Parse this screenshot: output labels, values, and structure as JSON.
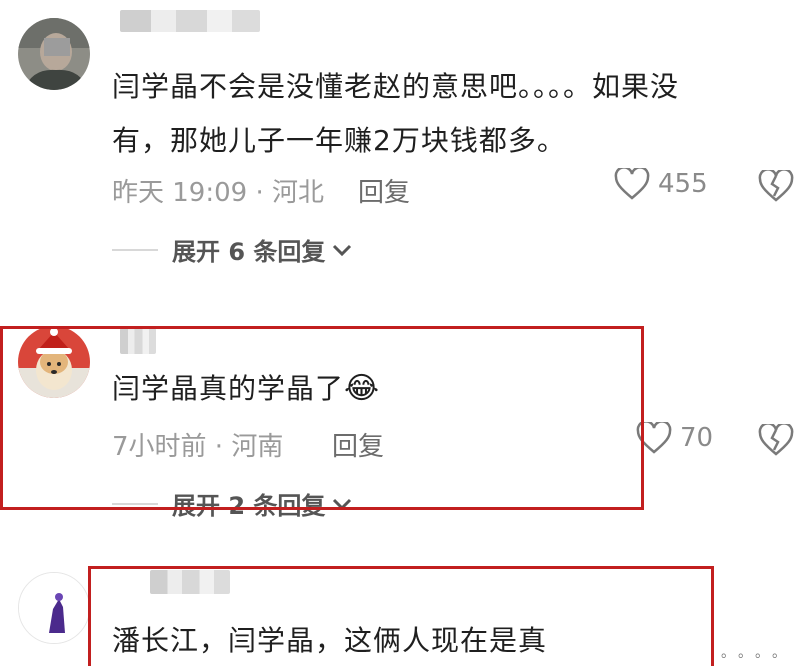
{
  "comments": [
    {
      "text_line1": "闫学晶不会是没懂老赵的意思吧。。。。如果没",
      "text_line2": "有，那她儿子一年赚2万块钱都多。",
      "meta": "昨天 19:09 · 河北",
      "reply_label": "回复",
      "likes": "455",
      "expand_label": "展开 6 条回复"
    },
    {
      "text": "闫学晶真的学晶了",
      "emoji": "😂",
      "meta": "7小时前 · 河南",
      "reply_label": "回复",
      "likes": "70",
      "expand_label": "展开 2 条回复"
    },
    {
      "text": "潘长江，闫学晶，这俩人现在是真"
    }
  ],
  "watermark": "。。。。",
  "colors": {
    "highlight_border": "#c21f1f",
    "meta_text": "#9a9a9a"
  }
}
